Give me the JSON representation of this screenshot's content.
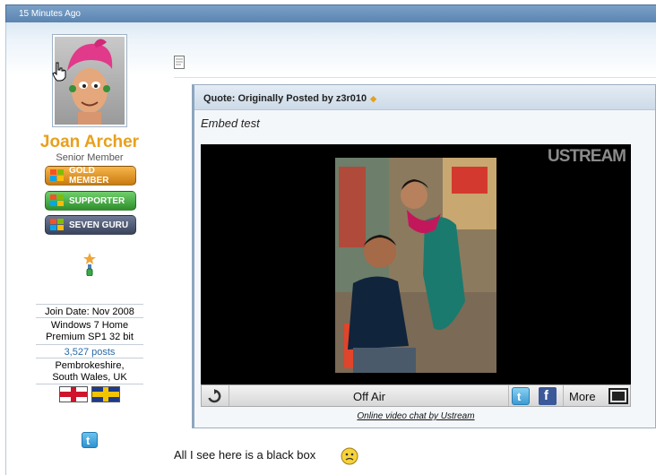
{
  "post_header": {
    "time": "15 Minutes Ago"
  },
  "user": {
    "name": "Joan Archer",
    "title": "Senior Member",
    "badges": [
      {
        "label": "GOLD MEMBER"
      },
      {
        "label": "SUPPORTER"
      },
      {
        "label": "SEVEN GURU"
      }
    ],
    "join_date": "Join Date: Nov 2008",
    "os_line1": "Windows 7 Home",
    "os_line2": "Premium SP1 32 bit",
    "posts": "3,527 posts",
    "location_line1": "Pembrokeshire,",
    "location_line2": "South Wales, UK"
  },
  "quote": {
    "header": "Quote: Originally Posted by z3r010",
    "text": "Embed test"
  },
  "player": {
    "logo": "USTREAM",
    "status": "Off Air",
    "more_label": "More",
    "link_text": "Online video chat by Ustream"
  },
  "message": {
    "text": "All I see here is a black box"
  },
  "colors": {
    "username": "#e8a01c",
    "header_bar": "#6a92bc",
    "posts_link": "#2a6aa8"
  }
}
